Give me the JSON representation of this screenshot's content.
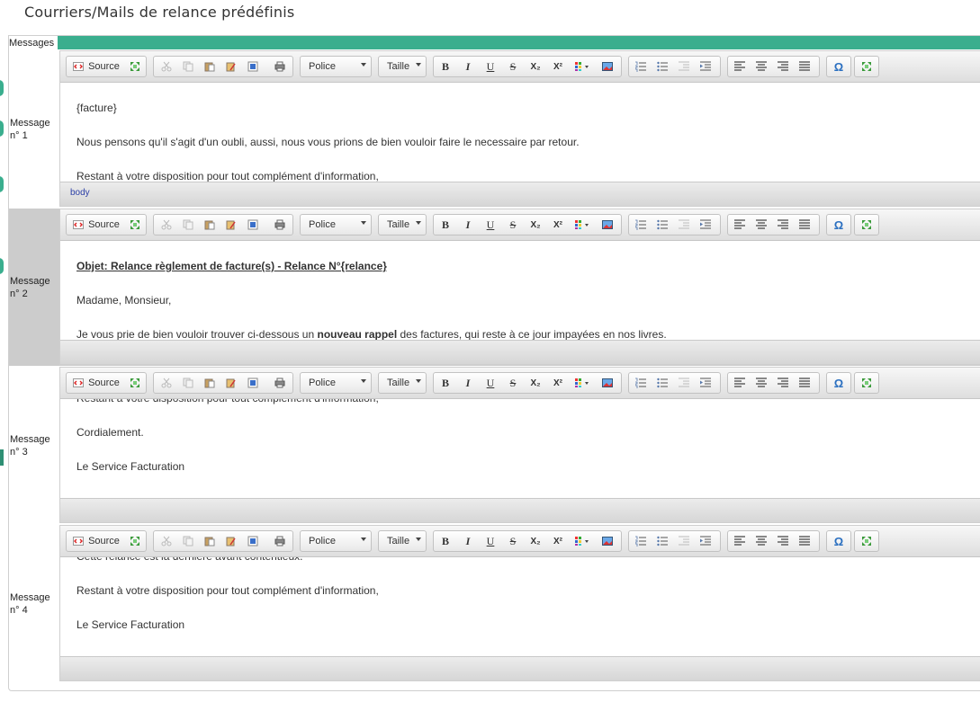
{
  "page": {
    "title": "Courriers/Mails de relance prédéfinis",
    "tab_label": "Messages"
  },
  "toolbar": {
    "source_label": "Source",
    "font_label": "Police",
    "size_label": "Taille",
    "bold": "B",
    "italic": "I",
    "underline": "U",
    "strike": "S",
    "sub": "X₂",
    "sup": "X²",
    "omega": "Ω"
  },
  "messages": [
    {
      "label": "Message n° 1",
      "lines": [
        "{facture}",
        "Nous pensons qu'il s'agit d'un oubli, aussi, nous vous prions de bien vouloir faire le necessaire par retour.",
        "Restant à votre disposition pour tout complément d'information,"
      ],
      "path": "body"
    },
    {
      "label": "Message n° 2",
      "subject": "Objet: Relance règlement de facture(s) - Relance N°{relance}",
      "line2": "Madame, Monsieur,",
      "line3_pre": "Je vous prie de bien vouloir trouver ci-dessous un ",
      "line3_bold": "nouveau rappel",
      "line3_post": " des factures, qui reste à ce jour impayées en nos livres."
    },
    {
      "label": "Message n° 3",
      "lines": [
        "Restant à votre disposition pour tout complément d'information,",
        "Cordialement.",
        "Le Service Facturation"
      ]
    },
    {
      "label": "Message n° 4",
      "lines": [
        "Cette relance est la dernière avant contentieux.",
        "Restant à votre disposition pour tout complément d'information,",
        "Le Service Facturation"
      ]
    }
  ],
  "colors": {
    "accent": "#3aae8e",
    "selected_row": "#cccccc"
  }
}
